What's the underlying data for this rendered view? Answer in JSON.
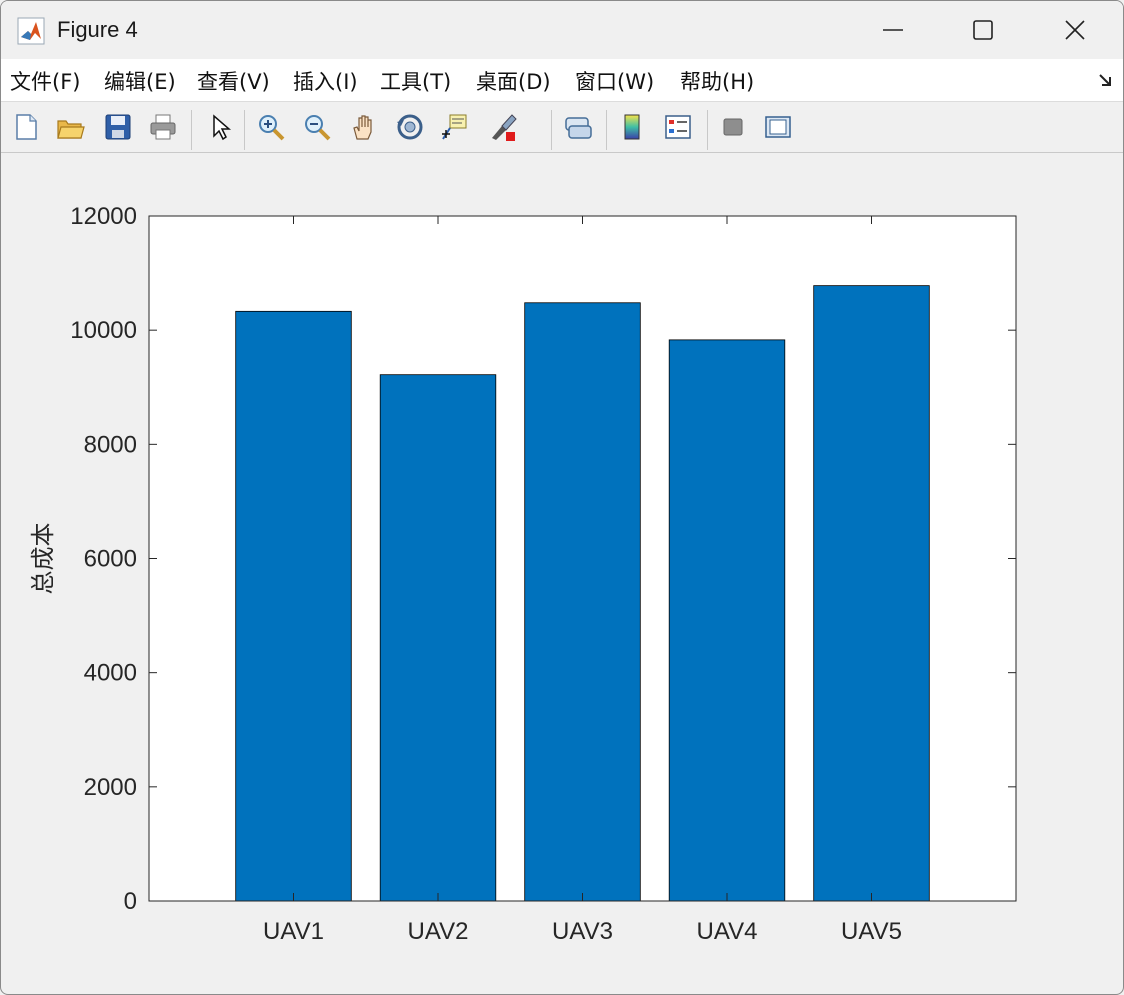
{
  "window": {
    "title": "Figure 4"
  },
  "window_controls": {
    "minimize_icon": "minimize-icon",
    "maximize_icon": "maximize-icon",
    "close_icon": "close-icon"
  },
  "menu": {
    "items": [
      {
        "label": "文件(F)"
      },
      {
        "label": "编辑(E)"
      },
      {
        "label": "查看(V)"
      },
      {
        "label": "插入(I)"
      },
      {
        "label": "工具(T)"
      },
      {
        "label": "桌面(D)"
      },
      {
        "label": "窗口(W)"
      },
      {
        "label": "帮助(H)"
      }
    ]
  },
  "toolbar": {
    "icons": [
      "new-figure-icon",
      "open-file-icon",
      "save-icon",
      "print-icon",
      "pointer-icon",
      "zoom-in-icon",
      "zoom-out-icon",
      "pan-hand-icon",
      "rotate-3d-icon",
      "data-cursor-icon",
      "brush-icon",
      "link-plot-icon",
      "colorbar-icon",
      "legend-icon",
      "hide-plot-tools-icon",
      "show-plot-tools-icon"
    ]
  },
  "accent": {
    "bar_color": "#0072bd",
    "axes_color": "#262626"
  },
  "chart_data": {
    "type": "bar",
    "categories": [
      "UAV1",
      "UAV2",
      "UAV3",
      "UAV4",
      "UAV5"
    ],
    "values": [
      10330,
      9220,
      10480,
      9830,
      10780
    ],
    "title": "",
    "xlabel": "",
    "ylabel": "总成本",
    "ylim": [
      0,
      12000
    ],
    "yticks": [
      0,
      2000,
      4000,
      6000,
      8000,
      10000,
      12000
    ],
    "grid": false,
    "legend": false
  }
}
